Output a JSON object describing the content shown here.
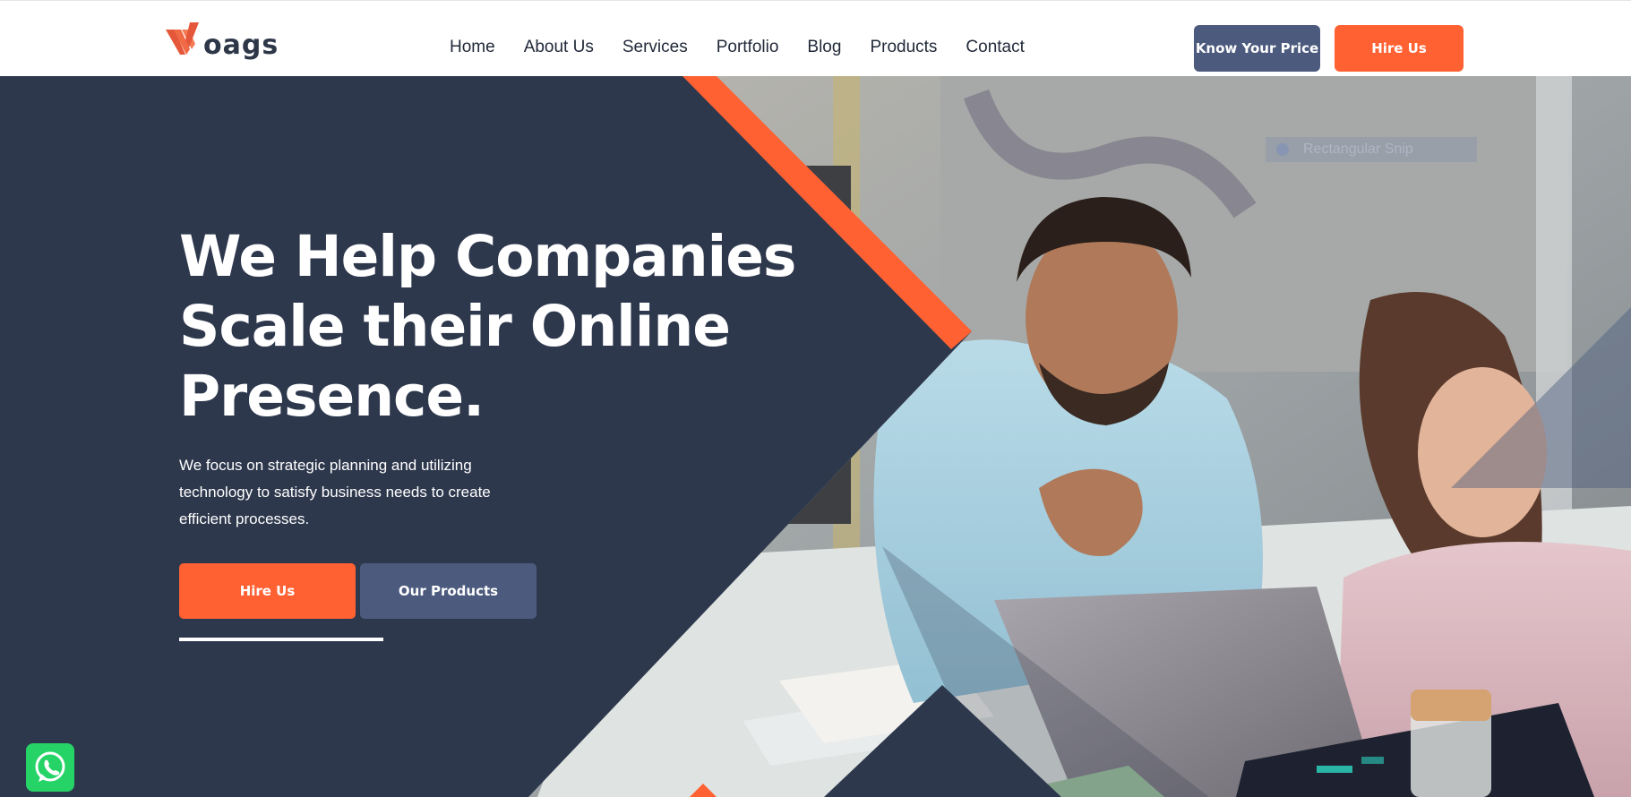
{
  "header": {
    "logo_text": "oags",
    "nav": [
      "Home",
      "About Us",
      "Services",
      "Portfolio",
      "Blog",
      "Products",
      "Contact"
    ],
    "know_price_label": "Know Your Price",
    "hire_label": "Hire Us"
  },
  "hero": {
    "headline": "We Help Companies Scale their Online Presence.",
    "description": "We focus on strategic planning and utilizing technology to satisfy business needs to create efficient processes.",
    "primary_button": "Hire Us",
    "secondary_button": "Our Products",
    "overlay_label": "Rectangular Snip"
  },
  "icons": {
    "logo": "voags-logo-mark",
    "whatsapp": "whatsapp-icon"
  },
  "colors": {
    "accent": "#ff6133",
    "navy": "#2e384d",
    "slate_button": "#4b5a7d",
    "whatsapp": "#25d366"
  }
}
